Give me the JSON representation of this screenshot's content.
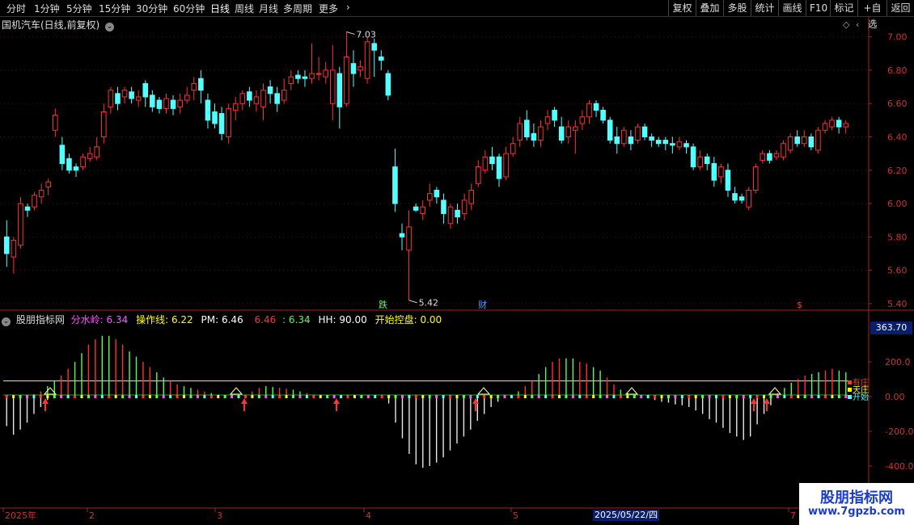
{
  "toolbar": {
    "left_items": [
      "分时",
      "1分钟",
      "5分钟",
      "15分钟",
      "30分钟",
      "60分钟",
      "日线",
      "周线",
      "月线",
      "多周期",
      "更多"
    ],
    "active": "日线",
    "right_items": [
      "复权",
      "叠加",
      "多股",
      "统计",
      "画线",
      "F10",
      "标记",
      "+自选",
      "返回"
    ]
  },
  "main_title": "国机汽车(日线,前复权)",
  "main_axis": [
    "7.00",
    "6.80",
    "6.60",
    "6.40",
    "6.20",
    "6.00",
    "5.80",
    "5.60",
    "5.40"
  ],
  "annotations": {
    "high": "7.03",
    "low": "5.42",
    "mark_die": "跌",
    "mark_cai": "财",
    "mark_s": "$"
  },
  "indicator": {
    "name": "股朋指标网",
    "fsl_label": "分水岭:",
    "fsl_value": "6.34",
    "czx_label": "操作线:",
    "czx_value": "6.22",
    "pm_label": "PM:",
    "pm_value": "6.46",
    "v1": "6.46",
    "v2": ": 6.34",
    "hh_label": "HH:",
    "hh_value": "90.00",
    "kskp_label": "开始控盘:",
    "kskp_value": "0.00"
  },
  "indicator_axis": [
    "200.0",
    "0.00",
    "-200.0",
    "-400.0"
  ],
  "indicator_current": "363.70",
  "legend_right": [
    "有庄",
    "天庄",
    "开始"
  ],
  "bottom_dates": [
    "2025年",
    "2",
    "3",
    "4",
    "5",
    "7"
  ],
  "date_highlight": "2025/05/22/四",
  "watermark": {
    "name": "股朋指标网",
    "url": "www.7gpzb.com"
  },
  "colors": {
    "up": "#ff3232",
    "down": "#54ffff",
    "axis": "#cc3333",
    "yellow": "#ffff00",
    "magenta": "#ff55ff"
  },
  "chart_data": {
    "type": "candlestick",
    "ylim": [
      5.38,
      7.1
    ],
    "candles": [
      [
        5.8,
        5.7,
        5.9,
        5.62
      ],
      [
        5.68,
        5.78,
        5.8,
        5.58
      ],
      [
        5.75,
        6.0,
        6.04,
        5.73
      ],
      [
        5.98,
        5.96,
        6.0,
        5.92
      ],
      [
        5.98,
        6.05,
        6.07,
        5.96
      ],
      [
        6.04,
        6.08,
        6.12,
        6.0
      ],
      [
        6.1,
        6.13,
        6.15,
        6.05
      ],
      [
        6.44,
        6.53,
        6.57,
        6.4
      ],
      [
        6.35,
        6.24,
        6.4,
        6.2
      ],
      [
        6.27,
        6.2,
        6.3,
        6.18
      ],
      [
        6.22,
        6.2,
        6.24,
        6.16
      ],
      [
        6.22,
        6.28,
        6.3,
        6.2
      ],
      [
        6.27,
        6.3,
        6.34,
        6.25
      ],
      [
        6.28,
        6.34,
        6.4,
        6.26
      ],
      [
        6.4,
        6.55,
        6.6,
        6.36
      ],
      [
        6.58,
        6.68,
        6.7,
        6.54
      ],
      [
        6.66,
        6.6,
        6.7,
        6.56
      ],
      [
        6.64,
        6.68,
        6.7,
        6.6
      ],
      [
        6.67,
        6.63,
        6.7,
        6.6
      ],
      [
        6.62,
        6.64,
        6.68,
        6.58
      ],
      [
        6.72,
        6.64,
        6.74,
        6.58
      ],
      [
        6.65,
        6.58,
        6.68,
        6.55
      ],
      [
        6.62,
        6.57,
        6.64,
        6.54
      ],
      [
        6.57,
        6.63,
        6.66,
        6.54
      ],
      [
        6.62,
        6.57,
        6.65,
        6.53
      ],
      [
        6.58,
        6.62,
        6.66,
        6.54
      ],
      [
        6.62,
        6.65,
        6.7,
        6.6
      ],
      [
        6.68,
        6.72,
        6.76,
        6.62
      ],
      [
        6.75,
        6.68,
        6.8,
        6.6
      ],
      [
        6.62,
        6.5,
        6.66,
        6.45
      ],
      [
        6.55,
        6.48,
        6.6,
        6.45
      ],
      [
        6.54,
        6.42,
        6.58,
        6.38
      ],
      [
        6.4,
        6.57,
        6.6,
        6.36
      ],
      [
        6.56,
        6.6,
        6.64,
        6.5
      ],
      [
        6.6,
        6.66,
        6.68,
        6.56
      ],
      [
        6.67,
        6.62,
        6.7,
        6.58
      ],
      [
        6.6,
        6.64,
        6.68,
        6.55
      ],
      [
        6.58,
        6.68,
        6.72,
        6.5
      ],
      [
        6.7,
        6.66,
        6.74,
        6.6
      ],
      [
        6.66,
        6.6,
        6.7,
        6.55
      ],
      [
        6.62,
        6.68,
        6.75,
        6.6
      ],
      [
        6.72,
        6.76,
        6.8,
        6.68
      ],
      [
        6.77,
        6.75,
        6.8,
        6.72
      ],
      [
        6.76,
        6.75,
        6.8,
        6.7
      ],
      [
        6.75,
        6.78,
        6.96,
        6.72
      ],
      [
        6.78,
        6.78,
        6.88,
        6.74
      ],
      [
        6.76,
        6.8,
        6.85,
        6.72
      ],
      [
        6.6,
        6.8,
        6.95,
        6.5
      ],
      [
        6.78,
        6.58,
        6.82,
        6.45
      ],
      [
        6.6,
        6.88,
        7.03,
        6.58
      ],
      [
        6.84,
        6.78,
        6.92,
        6.7
      ],
      [
        6.8,
        6.82,
        6.86,
        6.76
      ],
      [
        6.75,
        6.97,
        7.0,
        6.72
      ],
      [
        6.96,
        6.92,
        6.99,
        6.76
      ],
      [
        6.88,
        6.86,
        6.92,
        6.8
      ],
      [
        6.78,
        6.65,
        6.8,
        6.62
      ],
      [
        6.22,
        6.0,
        6.33,
        5.95
      ],
      [
        5.82,
        5.8,
        5.88,
        5.72
      ],
      [
        5.72,
        5.86,
        5.96,
        5.42
      ],
      [
        5.98,
        5.96,
        6.0,
        5.95
      ],
      [
        5.94,
        5.98,
        6.02,
        5.9
      ],
      [
        6.02,
        6.06,
        6.12,
        5.98
      ],
      [
        6.08,
        6.04,
        6.1,
        6.0
      ],
      [
        6.02,
        5.94,
        6.06,
        5.88
      ],
      [
        5.88,
        5.98,
        6.0,
        5.85
      ],
      [
        5.96,
        5.92,
        6.0,
        5.88
      ],
      [
        5.94,
        6.02,
        6.06,
        5.9
      ],
      [
        6.0,
        6.08,
        6.12,
        5.96
      ],
      [
        6.12,
        6.22,
        6.26,
        6.1
      ],
      [
        6.2,
        6.28,
        6.32,
        6.18
      ],
      [
        6.28,
        6.24,
        6.34,
        6.2
      ],
      [
        6.28,
        6.15,
        6.3,
        6.1
      ],
      [
        6.16,
        6.3,
        6.34,
        6.14
      ],
      [
        6.3,
        6.36,
        6.4,
        6.28
      ],
      [
        6.38,
        6.48,
        6.52,
        6.34
      ],
      [
        6.5,
        6.4,
        6.56,
        6.38
      ],
      [
        6.42,
        6.38,
        6.48,
        6.34
      ],
      [
        6.38,
        6.46,
        6.5,
        6.34
      ],
      [
        6.48,
        6.52,
        6.56,
        6.44
      ],
      [
        6.56,
        6.5,
        6.58,
        6.46
      ],
      [
        6.46,
        6.38,
        6.52,
        6.36
      ],
      [
        6.4,
        6.46,
        6.5,
        6.36
      ],
      [
        6.44,
        6.46,
        6.5,
        6.3
      ],
      [
        6.48,
        6.52,
        6.56,
        6.44
      ],
      [
        6.52,
        6.6,
        6.62,
        6.48
      ],
      [
        6.6,
        6.56,
        6.62,
        6.52
      ],
      [
        6.56,
        6.5,
        6.58,
        6.48
      ],
      [
        6.5,
        6.38,
        6.52,
        6.36
      ],
      [
        6.4,
        6.36,
        6.46,
        6.3
      ],
      [
        6.36,
        6.44,
        6.46,
        6.34
      ],
      [
        6.4,
        6.36,
        6.44,
        6.32
      ],
      [
        6.38,
        6.46,
        6.48,
        6.36
      ],
      [
        6.46,
        6.4,
        6.48,
        6.38
      ],
      [
        6.4,
        6.38,
        6.42,
        6.34
      ],
      [
        6.38,
        6.36,
        6.4,
        6.34
      ],
      [
        6.38,
        6.36,
        6.4,
        6.32
      ],
      [
        6.36,
        6.35,
        6.4,
        6.3
      ],
      [
        6.34,
        6.37,
        6.4,
        6.32
      ],
      [
        6.36,
        6.34,
        6.38,
        6.3
      ],
      [
        6.34,
        6.22,
        6.36,
        6.2
      ],
      [
        6.22,
        6.28,
        6.32,
        6.2
      ],
      [
        6.28,
        6.24,
        6.3,
        6.2
      ],
      [
        6.24,
        6.14,
        6.28,
        6.1
      ],
      [
        6.16,
        6.22,
        6.24,
        6.12
      ],
      [
        6.2,
        6.08,
        6.24,
        6.04
      ],
      [
        6.06,
        6.02,
        6.1,
        6.0
      ],
      [
        6.04,
        6.02,
        6.06,
        6.0
      ],
      [
        5.98,
        6.08,
        6.1,
        5.96
      ],
      [
        6.08,
        6.22,
        6.24,
        6.06
      ],
      [
        6.26,
        6.3,
        6.32,
        6.24
      ],
      [
        6.3,
        6.26,
        6.32,
        6.24
      ],
      [
        6.28,
        6.3,
        6.32,
        6.26
      ],
      [
        6.28,
        6.36,
        6.38,
        6.26
      ],
      [
        6.32,
        6.4,
        6.42,
        6.3
      ],
      [
        6.4,
        6.36,
        6.44,
        6.34
      ],
      [
        6.36,
        6.4,
        6.44,
        6.34
      ],
      [
        6.4,
        6.34,
        6.42,
        6.32
      ],
      [
        6.32,
        6.44,
        6.46,
        6.3
      ],
      [
        6.44,
        6.48,
        6.5,
        6.42
      ],
      [
        6.46,
        6.5,
        6.52,
        6.44
      ],
      [
        6.5,
        6.46,
        6.52,
        6.42
      ],
      [
        6.46,
        6.48,
        6.5,
        6.42
      ]
    ],
    "indicator_bars": [
      [
        -170,
        0
      ],
      [
        -220,
        0
      ],
      [
        -190,
        5
      ],
      [
        -150,
        10
      ],
      [
        -100,
        15
      ],
      [
        -60,
        30
      ],
      [
        -20,
        60
      ],
      [
        0,
        90
      ],
      [
        0,
        120
      ],
      [
        0,
        160
      ],
      [
        0,
        200
      ],
      [
        0,
        250
      ],
      [
        0,
        300
      ],
      [
        0,
        330
      ],
      [
        0,
        350
      ],
      [
        0,
        350
      ],
      [
        0,
        330
      ],
      [
        0,
        300
      ],
      [
        0,
        260
      ],
      [
        0,
        230
      ],
      [
        0,
        200
      ],
      [
        0,
        170
      ],
      [
        0,
        140
      ],
      [
        0,
        110
      ],
      [
        0,
        90
      ],
      [
        0,
        70
      ],
      [
        0,
        60
      ],
      [
        0,
        50
      ],
      [
        0,
        40
      ],
      [
        0,
        30
      ],
      [
        0,
        20
      ],
      [
        0,
        10
      ],
      [
        0,
        5
      ],
      [
        0,
        5
      ],
      [
        0,
        8
      ],
      [
        0,
        10
      ],
      [
        0,
        30
      ],
      [
        0,
        50
      ],
      [
        0,
        60
      ],
      [
        0,
        55
      ],
      [
        0,
        50
      ],
      [
        0,
        45
      ],
      [
        0,
        40
      ],
      [
        0,
        30
      ],
      [
        0,
        20
      ],
      [
        0,
        10
      ],
      [
        0,
        5
      ],
      [
        0,
        5
      ],
      [
        0,
        10
      ],
      [
        0,
        8
      ],
      [
        0,
        8
      ],
      [
        0,
        5
      ],
      [
        0,
        5
      ],
      [
        0,
        5
      ],
      [
        0,
        5
      ],
      [
        0,
        5
      ],
      [
        -40,
        0
      ],
      [
        -150,
        0
      ],
      [
        -240,
        0
      ],
      [
        -330,
        0
      ],
      [
        -390,
        0
      ],
      [
        -410,
        0
      ],
      [
        -400,
        0
      ],
      [
        -380,
        0
      ],
      [
        -350,
        0
      ],
      [
        -310,
        0
      ],
      [
        -270,
        0
      ],
      [
        -230,
        0
      ],
      [
        -190,
        0
      ],
      [
        -140,
        0
      ],
      [
        -100,
        0
      ],
      [
        -60,
        0
      ],
      [
        -30,
        0
      ],
      [
        0,
        0
      ],
      [
        0,
        10
      ],
      [
        0,
        30
      ],
      [
        0,
        60
      ],
      [
        0,
        90
      ],
      [
        0,
        130
      ],
      [
        0,
        170
      ],
      [
        0,
        200
      ],
      [
        0,
        220
      ],
      [
        0,
        220
      ],
      [
        0,
        220
      ],
      [
        0,
        200
      ],
      [
        0,
        190
      ],
      [
        0,
        170
      ],
      [
        0,
        150
      ],
      [
        0,
        110
      ],
      [
        0,
        70
      ],
      [
        0,
        40
      ],
      [
        0,
        20
      ],
      [
        0,
        10
      ],
      [
        0,
        5
      ],
      [
        -10,
        0
      ],
      [
        -20,
        0
      ],
      [
        -30,
        0
      ],
      [
        -35,
        0
      ],
      [
        -45,
        0
      ],
      [
        -50,
        0
      ],
      [
        -60,
        0
      ],
      [
        -80,
        0
      ],
      [
        -100,
        0
      ],
      [
        -130,
        0
      ],
      [
        -150,
        0
      ],
      [
        -180,
        0
      ],
      [
        -210,
        0
      ],
      [
        -230,
        0
      ],
      [
        -250,
        0
      ],
      [
        -230,
        0
      ],
      [
        -160,
        0
      ],
      [
        -100,
        0
      ],
      [
        -50,
        0
      ],
      [
        0,
        20
      ],
      [
        0,
        50
      ],
      [
        0,
        80
      ],
      [
        0,
        100
      ],
      [
        0,
        120
      ],
      [
        0,
        130
      ],
      [
        0,
        140
      ],
      [
        0,
        150
      ],
      [
        0,
        160
      ],
      [
        0,
        150
      ],
      [
        0,
        140
      ]
    ]
  }
}
